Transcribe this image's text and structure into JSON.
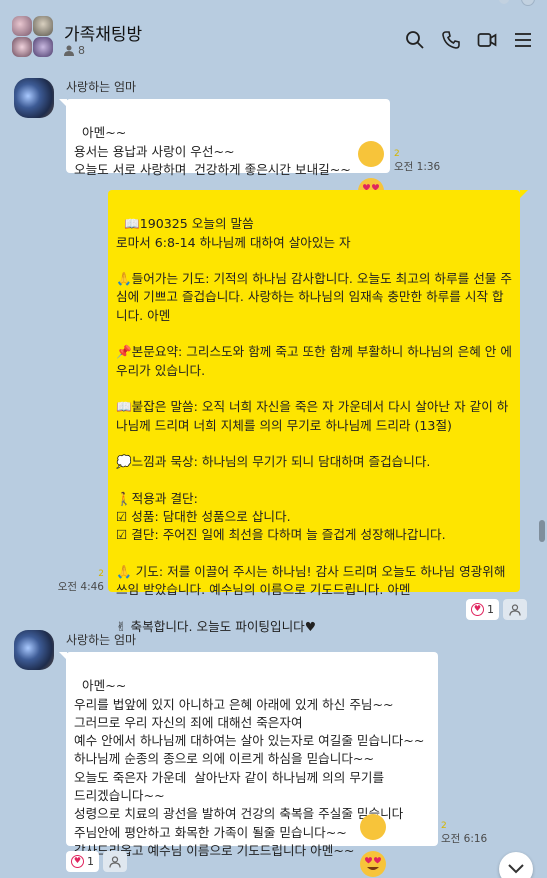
{
  "header": {
    "title": "가족채팅방",
    "member_count": "8",
    "icons": [
      "search-icon",
      "phone-icon",
      "video-icon",
      "menu-icon"
    ]
  },
  "messages": [
    {
      "sender": "사랑하는 엄마",
      "text": "아멘~~\n용서는 용납과 사랑이 우선~~\n오늘도 서로 사랑하며  건강하게 좋은시간 보내길~~",
      "emoji": "heart-eyes-emoji",
      "unread": "2",
      "time": "오전 1:36"
    },
    {
      "text": "📖190325 오늘의 말씀\n로마서 6:8-14 하나님께 대하여 살아있는 자\n\n🙏들어가는 기도: 기적의 하나님 감사합니다. 오늘도 최고의 하루를 선물 주심에 기쁘고 즐겁습니다. 사랑하는 하나님의 임재속 충만한 하루를 시작 합니다. 아멘\n\n📌본문요약: 그리스도와 함께 죽고 또한 함께 부활하니 하나님의 은혜 안 에 우리가 있습니다.\n\n📖붙잡은 말씀: 오직 너희 자신을 죽은 자 가운데서 다시 살아난 자 같이 하나님께 드리며 너희 지체를 의의 무기로 하나님께 드리라 (13절)\n\n💭느낌과 묵상: 하나님의 무기가 되니 담대하며 즐겁습니다.\n\n🚶적용과 결단:\n☑ 성품: 담대한 성품으로 삽니다.\n☑ 결단: 주어진 일에 최선을 다하며 늘 즐겁게 성장해나갑니다.\n\n🙏 기도: 저를 이끌어 주시는 하나님! 감사 드리며 오늘도 하나님 영광위해 쓰임 받았습니다. 예수님의 이름으로 기도드립니다. 아멘\n\n✌ 축복합니다. 오늘도 파이팅입니다♥",
      "unread": "2",
      "time": "오전 4:46",
      "reaction_count": "1"
    },
    {
      "sender": "사랑하는 엄마",
      "text": "아멘~~\n우리를 법앞에 있지 아니하고 은혜 아래에 있게 하신 주님~~\n그러므로 우리 자신의 죄에 대해선 죽은자여\n예수 안에서 하나님께 대하여는 살아 있는자로 여길줄 믿습니다~~\n하나님께 순종의 종으로 의에 이르게 하심을 믿습니다~~\n오늘도 죽은자 가운데  살아난자 같이 하나님께 의의 무기를\n드리겠습니다~~\n성령으로 치료의 광선을 발하여 건강의 축복을 주실줄 믿습니다\n주님안에 평안하고 화목한 가족이 될줄 믿습니다~~\n감사드리옵고 예수님 이름으로 기도드립니다 아멘~~",
      "emoji": "heart-eyes-emoji",
      "unread": "2",
      "time": "오전 6:16",
      "reaction_count": "1"
    }
  ]
}
